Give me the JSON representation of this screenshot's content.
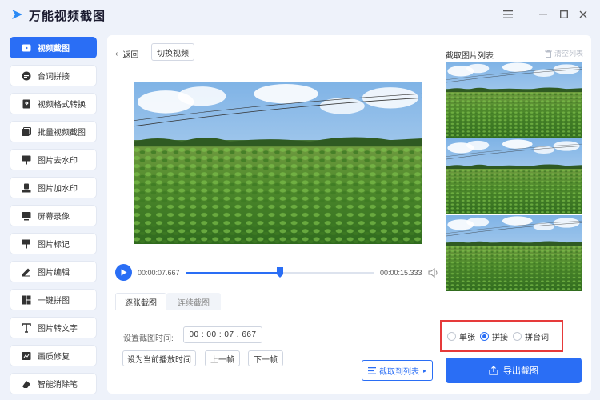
{
  "app": {
    "title": "万能视频截图"
  },
  "window": {
    "menu_icon": "menu-icon",
    "min_icon": "minimize-icon",
    "max_icon": "maximize-icon",
    "close_icon": "close-icon"
  },
  "sidebar": {
    "items": [
      {
        "label": "视频截图",
        "icon": "video-capture-icon",
        "active": true
      },
      {
        "label": "台词拼接",
        "icon": "subtitle-icon"
      },
      {
        "label": "视频格式转换",
        "icon": "convert-icon"
      },
      {
        "label": "批量视频截图",
        "icon": "batch-icon"
      },
      {
        "label": "图片去水印",
        "icon": "remove-watermark-icon"
      },
      {
        "label": "图片加水印",
        "icon": "add-watermark-icon"
      },
      {
        "label": "屏幕录像",
        "icon": "screen-record-icon"
      },
      {
        "label": "图片标记",
        "icon": "mark-icon"
      },
      {
        "label": "图片编辑",
        "icon": "edit-icon"
      },
      {
        "label": "一键拼图",
        "icon": "collage-icon"
      },
      {
        "label": "图片转文字",
        "icon": "ocr-icon"
      },
      {
        "label": "画质修复",
        "icon": "repair-icon"
      },
      {
        "label": "智能消除笔",
        "icon": "eraser-icon"
      }
    ]
  },
  "toolbar": {
    "back_label": "返回",
    "switch_label": "切换视频"
  },
  "player": {
    "current_time": "00:00:07.667",
    "total_time": "00:00:15.333",
    "progress": 0.5
  },
  "tabs": [
    {
      "label": "逐张截图",
      "active": true
    },
    {
      "label": "连续截图",
      "active": false
    }
  ],
  "capture": {
    "time_label": "设置截图时间:",
    "time_value": "00 : 00 : 07 . 667",
    "set_current_label": "设为当前播放时间",
    "prev_frame_label": "上一帧",
    "next_frame_label": "下一帧",
    "crop_to_list_label": "截取到列表"
  },
  "list": {
    "title": "截取图片列表",
    "clear_label": "清空列表"
  },
  "mode": {
    "options": [
      {
        "label": "单张",
        "checked": false
      },
      {
        "label": "拼接",
        "checked": true
      },
      {
        "label": "拼台词",
        "checked": false
      }
    ]
  },
  "export": {
    "label": "导出截图"
  },
  "colors": {
    "accent": "#2a6ef5",
    "highlight_border": "#e63a3a"
  }
}
